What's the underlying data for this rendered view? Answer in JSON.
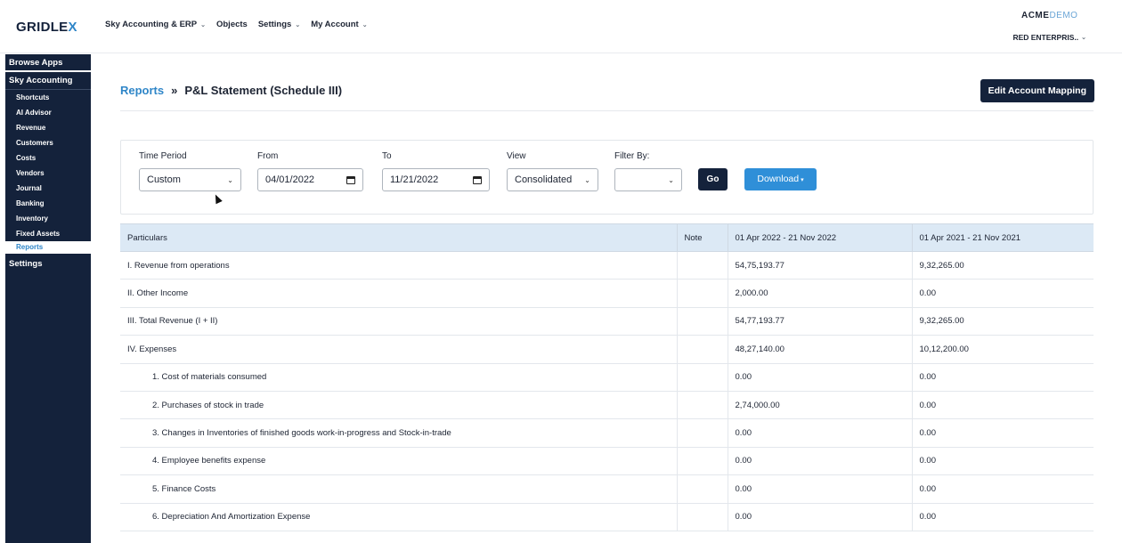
{
  "app": {
    "logo_main": "GRIDLE",
    "logo_accent": "X"
  },
  "topnav": [
    {
      "label": "Sky Accounting & ERP",
      "has_caret": true
    },
    {
      "label": "Objects",
      "has_caret": false
    },
    {
      "label": "Settings",
      "has_caret": true
    },
    {
      "label": "My Account",
      "has_caret": true
    }
  ],
  "account": {
    "brand_main": "ACME",
    "brand_accent": "DEMO",
    "org": "RED ENTERPRIS.."
  },
  "sidebar": {
    "browse": "Browse Apps",
    "section": "Sky Accounting",
    "items": [
      {
        "label": "Shortcuts"
      },
      {
        "label": "AI Advisor"
      },
      {
        "label": "Revenue"
      },
      {
        "label": "Customers"
      },
      {
        "label": "Costs"
      },
      {
        "label": "Vendors"
      },
      {
        "label": "Journal"
      },
      {
        "label": "Banking"
      },
      {
        "label": "Inventory"
      },
      {
        "label": "Fixed Assets"
      },
      {
        "label": "Reports"
      }
    ],
    "active": "Reports",
    "settings": "Settings"
  },
  "breadcrumb": {
    "root": "Reports",
    "separator": "»",
    "current": "P&L Statement (Schedule III)"
  },
  "actions": {
    "edit_mapping": "Edit Account Mapping",
    "go": "Go",
    "download": "Download"
  },
  "filters": {
    "time_period_label": "Time Period",
    "time_period_value": "Custom",
    "from_label": "From",
    "from_value": "04/01/2022",
    "to_label": "To",
    "to_value": "11/21/2022",
    "view_label": "View",
    "view_value": "Consolidated",
    "filter_by_label": "Filter By:",
    "filter_by_value": ""
  },
  "table": {
    "headers": [
      "Particulars",
      "Note",
      "01 Apr 2022 - 21 Nov 2022",
      "01 Apr 2021 - 21 Nov 2021"
    ],
    "rows": [
      {
        "particular": "I. Revenue from operations",
        "note": "",
        "current": "54,75,193.77",
        "previous": "9,32,265.00",
        "indent": false
      },
      {
        "particular": "II. Other Income",
        "note": "",
        "current": "2,000.00",
        "previous": "0.00",
        "indent": false
      },
      {
        "particular": "III. Total Revenue (I + II)",
        "note": "",
        "current": "54,77,193.77",
        "previous": "9,32,265.00",
        "indent": false
      },
      {
        "particular": "IV. Expenses",
        "note": "",
        "current": "48,27,140.00",
        "previous": "10,12,200.00",
        "indent": false
      },
      {
        "particular": "1. Cost of materials consumed",
        "note": "",
        "current": "0.00",
        "previous": "0.00",
        "indent": true
      },
      {
        "particular": "2. Purchases of stock in trade",
        "note": "",
        "current": "2,74,000.00",
        "previous": "0.00",
        "indent": true
      },
      {
        "particular": "3. Changes in Inventories of finished goods work-in-progress and Stock-in-trade",
        "note": "",
        "current": "0.00",
        "previous": "0.00",
        "indent": true
      },
      {
        "particular": "4. Employee benefits expense",
        "note": "",
        "current": "0.00",
        "previous": "0.00",
        "indent": true
      },
      {
        "particular": "5. Finance Costs",
        "note": "",
        "current": "0.00",
        "previous": "0.00",
        "indent": true
      },
      {
        "particular": "6. Depreciation And Amortization Expense",
        "note": "",
        "current": "0.00",
        "previous": "0.00",
        "indent": true
      }
    ]
  },
  "icons": {
    "caret": "chevron-down-icon",
    "calendar": "calendar-icon",
    "cursor": "mouse-cursor-icon"
  },
  "colors": {
    "navy": "#14223b",
    "accent": "#2f86c8",
    "download": "#2f8fd8",
    "table_header": "#dce9f5"
  }
}
